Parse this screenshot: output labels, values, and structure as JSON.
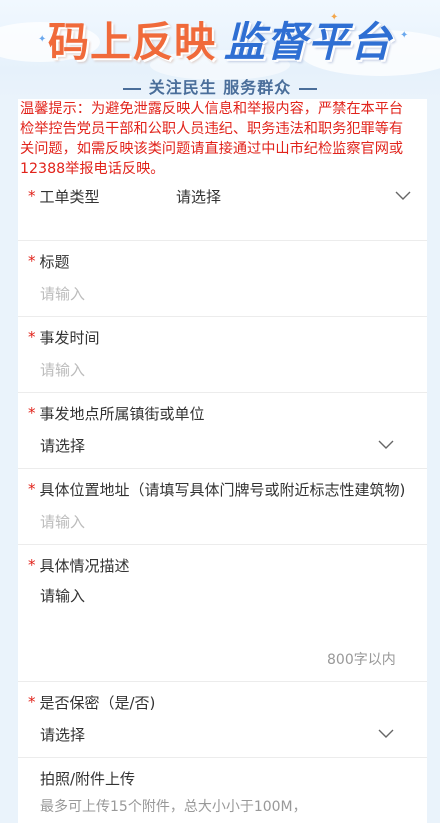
{
  "banner": {
    "title_part1": "码上反映",
    "title_part2": "监督平台",
    "subtitle": "关注民生 服务群众"
  },
  "notice": "温馨提示：为避免泄露反映人信息和举报内容，严禁在本平台检举控告党员干部和公职人员违纪、职务违法和职务犯罪等有关问题，如需反映该类问题请直接通过中山市纪检监察官网或12388举报电话反映。",
  "form": {
    "required_mark": "*",
    "ticket_type": {
      "label": "工单类型",
      "value": "请选择"
    },
    "title": {
      "label": "标题",
      "placeholder": "请输入"
    },
    "time": {
      "label": "事发时间",
      "placeholder": "请输入"
    },
    "town": {
      "label": "事发地点所属镇街或单位",
      "value": "请选择"
    },
    "address": {
      "label": "具体位置地址（请填写具体门牌号或附近标志性建筑物)",
      "placeholder": "请输入"
    },
    "description": {
      "label": "具体情况描述",
      "placeholder": "请输入",
      "counter": "800字以内"
    },
    "confidential": {
      "label": "是否保密（是/否)",
      "value": "请选择"
    },
    "attachment": {
      "label": "拍照/附件上传",
      "hint": "最多可上传15个附件，总大小小于100M，"
    }
  }
}
